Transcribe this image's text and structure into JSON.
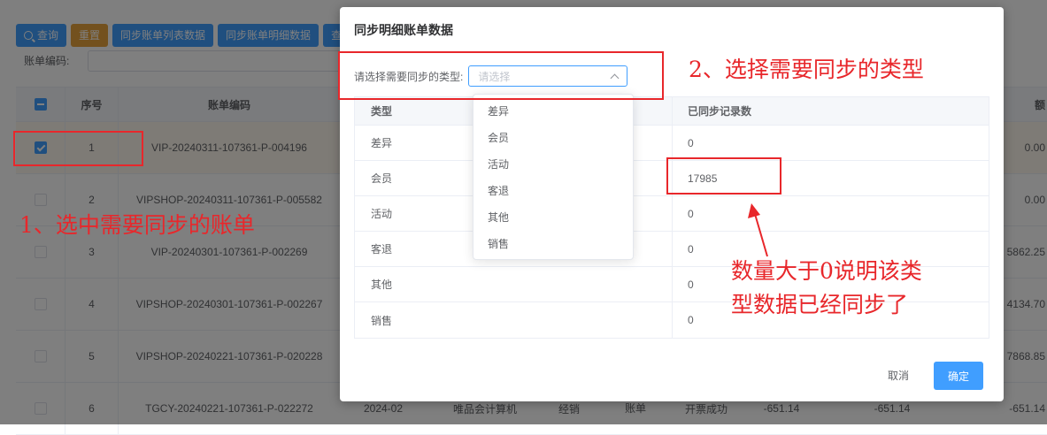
{
  "toolbar": {
    "buttons": [
      "查询",
      "重置",
      "同步账单列表数据",
      "同步账单明细数据",
      "查"
    ]
  },
  "filter": {
    "label": "账单编码:"
  },
  "grid": {
    "headers": {
      "num": "序号",
      "code": "账单编码",
      "amount": "额"
    },
    "rows": [
      {
        "num": "1",
        "code": "VIP-20240311-107361-P-004196",
        "amt": "0.00",
        "checked": true
      },
      {
        "num": "2",
        "code": "VIPSHOP-20240311-107361-P-005582",
        "amt": "0.00"
      },
      {
        "num": "3",
        "code": "VIP-20240301-107361-P-002269",
        "amt": "5862.25"
      },
      {
        "num": "4",
        "code": "VIPSHOP-20240301-107361-P-002267",
        "amt": "4134.70"
      },
      {
        "num": "5",
        "code": "VIPSHOP-20240221-107361-P-020228",
        "amt": "7868.85"
      },
      {
        "num": "6",
        "code": "TGCY-20240221-107361-P-022272",
        "month": "2024-02",
        "company": "唯品会计算机",
        "mode": "经销",
        "type": "账单",
        "status": "开票成功",
        "amt1": "-651.14",
        "amt2": "-651.14",
        "amt": "-651.14"
      }
    ]
  },
  "dialog": {
    "title": "同步明细账单数据",
    "select_label": "请选择需要同步的类型:",
    "select_placeholder": "请选择",
    "table": {
      "col_type": "类型",
      "col_count": "已同步记录数",
      "rows": [
        {
          "type": "差异",
          "count": "0"
        },
        {
          "type": "会员",
          "count": "17985"
        },
        {
          "type": "活动",
          "count": "0"
        },
        {
          "type": "客退",
          "count": "0"
        },
        {
          "type": "其他",
          "count": "0"
        },
        {
          "type": "销售",
          "count": "0"
        }
      ]
    },
    "dropdown_options": [
      "差异",
      "会员",
      "活动",
      "客退",
      "其他",
      "销售"
    ],
    "cancel_label": "取消",
    "ok_label": "确定"
  },
  "annotations": {
    "step1": "1、选中需要同步的账单",
    "step2": "2、选择需要同步的类型",
    "note_line1": "数量大于0说明该类",
    "note_line2": "型数据已经同步了"
  },
  "colors": {
    "primary": "#409eff",
    "warning": "#e6a23c",
    "annotation_red": "#e8272b"
  }
}
